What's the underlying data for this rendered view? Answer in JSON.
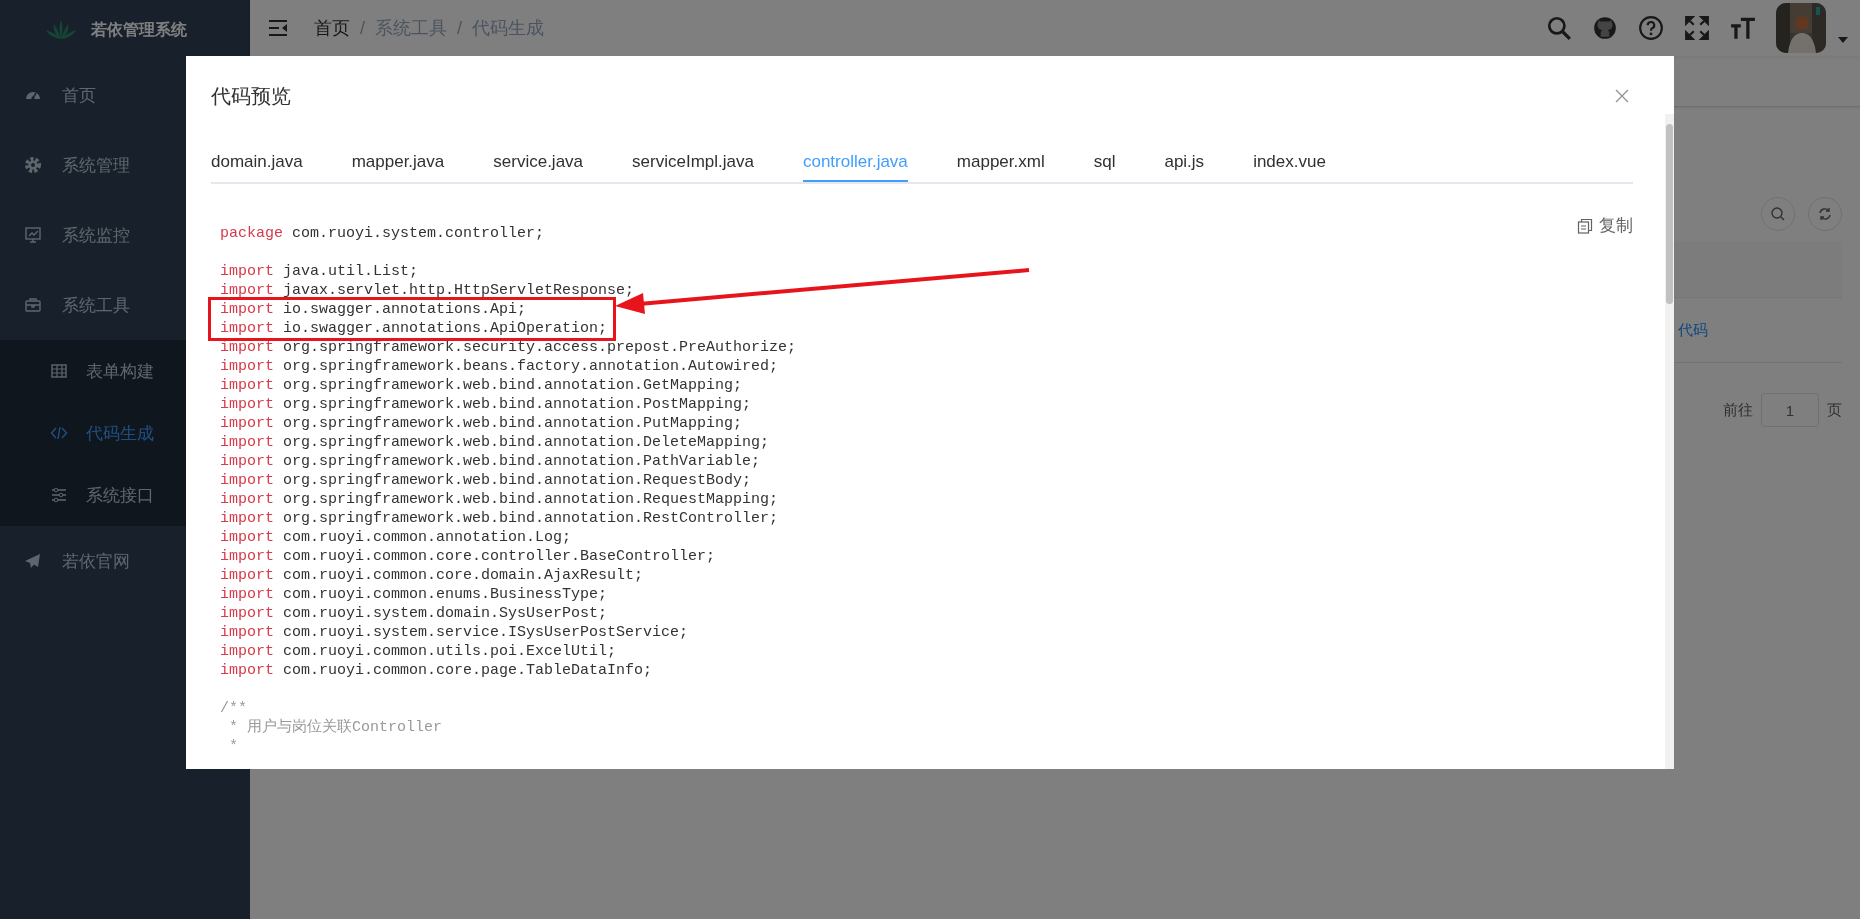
{
  "sidebar": {
    "title": "若依管理系统",
    "items": [
      {
        "label": "首页"
      },
      {
        "label": "系统管理"
      },
      {
        "label": "系统监控"
      },
      {
        "label": "系统工具",
        "expanded": true,
        "children": [
          {
            "label": "表单构建",
            "selected": false
          },
          {
            "label": "代码生成",
            "selected": true
          },
          {
            "label": "系统接口",
            "selected": false
          }
        ]
      },
      {
        "label": "若依官网"
      }
    ]
  },
  "breadcrumb": {
    "separator": "/",
    "items": [
      "首页",
      "系统工具",
      "代码生成"
    ]
  },
  "background_page": {
    "link": "代码",
    "pagination": {
      "goto_label": "前往",
      "page": "1",
      "page_suffix": "页"
    }
  },
  "dialog": {
    "title": "代码预览",
    "tabs": [
      {
        "label": "domain.java",
        "selected": false
      },
      {
        "label": "mapper.java",
        "selected": false
      },
      {
        "label": "service.java",
        "selected": false
      },
      {
        "label": "serviceImpl.java",
        "selected": false
      },
      {
        "label": "controller.java",
        "selected": true
      },
      {
        "label": "mapper.xml",
        "selected": false
      },
      {
        "label": "sql",
        "selected": false
      },
      {
        "label": "api.js",
        "selected": false
      },
      {
        "label": "index.vue",
        "selected": false
      }
    ],
    "copy_label": "复制",
    "code_blocks": [
      {
        "lines": [
          {
            "kind": "statement",
            "keyword": "package",
            "text": "com.ruoyi.system.controller;",
            "highlighted": false
          }
        ]
      },
      {
        "lines": [
          {
            "kind": "statement",
            "keyword": "import",
            "text": "java.util.List;",
            "highlighted": false
          },
          {
            "kind": "statement",
            "keyword": "import",
            "text": "javax.servlet.http.HttpServletResponse;",
            "highlighted": false
          },
          {
            "kind": "statement",
            "keyword": "import",
            "text": "io.swagger.annotations.Api;",
            "highlighted": true
          },
          {
            "kind": "statement",
            "keyword": "import",
            "text": "io.swagger.annotations.ApiOperation;",
            "highlighted": true
          },
          {
            "kind": "statement",
            "keyword": "import",
            "text": "org.springframework.security.access.prepost.PreAuthorize;",
            "highlighted": false
          },
          {
            "kind": "statement",
            "keyword": "import",
            "text": "org.springframework.beans.factory.annotation.Autowired;",
            "highlighted": false
          },
          {
            "kind": "statement",
            "keyword": "import",
            "text": "org.springframework.web.bind.annotation.GetMapping;",
            "highlighted": false
          },
          {
            "kind": "statement",
            "keyword": "import",
            "text": "org.springframework.web.bind.annotation.PostMapping;",
            "highlighted": false
          },
          {
            "kind": "statement",
            "keyword": "import",
            "text": "org.springframework.web.bind.annotation.PutMapping;",
            "highlighted": false
          },
          {
            "kind": "statement",
            "keyword": "import",
            "text": "org.springframework.web.bind.annotation.DeleteMapping;",
            "highlighted": false
          },
          {
            "kind": "statement",
            "keyword": "import",
            "text": "org.springframework.web.bind.annotation.PathVariable;",
            "highlighted": false
          },
          {
            "kind": "statement",
            "keyword": "import",
            "text": "org.springframework.web.bind.annotation.RequestBody;",
            "highlighted": false
          },
          {
            "kind": "statement",
            "keyword": "import",
            "text": "org.springframework.web.bind.annotation.RequestMapping;",
            "highlighted": false
          },
          {
            "kind": "statement",
            "keyword": "import",
            "text": "org.springframework.web.bind.annotation.RestController;",
            "highlighted": false
          },
          {
            "kind": "statement",
            "keyword": "import",
            "text": "com.ruoyi.common.annotation.Log;",
            "highlighted": false
          },
          {
            "kind": "statement",
            "keyword": "import",
            "text": "com.ruoyi.common.core.controller.BaseController;",
            "highlighted": false
          },
          {
            "kind": "statement",
            "keyword": "import",
            "text": "com.ruoyi.common.core.domain.AjaxResult;",
            "highlighted": false
          },
          {
            "kind": "statement",
            "keyword": "import",
            "text": "com.ruoyi.common.enums.BusinessType;",
            "highlighted": false
          },
          {
            "kind": "statement",
            "keyword": "import",
            "text": "com.ruoyi.system.domain.SysUserPost;",
            "highlighted": false
          },
          {
            "kind": "statement",
            "keyword": "import",
            "text": "com.ruoyi.system.service.ISysUserPostService;",
            "highlighted": false
          },
          {
            "kind": "statement",
            "keyword": "import",
            "text": "com.ruoyi.common.utils.poi.ExcelUtil;",
            "highlighted": false
          },
          {
            "kind": "statement",
            "keyword": "import",
            "text": "com.ruoyi.common.core.page.TableDataInfo;",
            "highlighted": false
          }
        ]
      },
      {
        "lines": [
          {
            "kind": "comment",
            "text": "/**",
            "highlighted": false
          },
          {
            "kind": "comment",
            "text": " * 用户与岗位关联Controller",
            "highlighted": false
          },
          {
            "kind": "comment",
            "text": " *",
            "highlighted": false
          }
        ]
      }
    ]
  }
}
